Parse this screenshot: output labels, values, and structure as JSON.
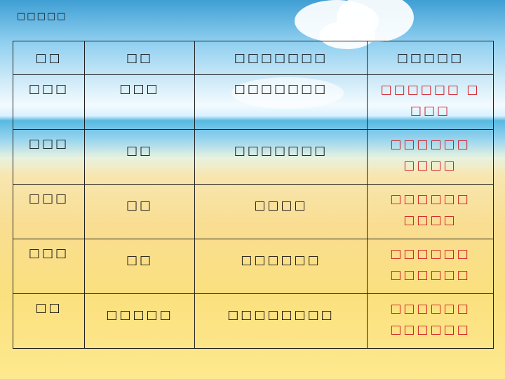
{
  "page": {
    "title": "□□□□□"
  },
  "table": {
    "headers": [
      "□□",
      "□□",
      "□□□□□□□",
      "□□□□□"
    ],
    "rows": [
      {
        "c1": "□□□",
        "c2": "□□□",
        "c3": "□□□□□□□",
        "c4a": "□□□□□□  □",
        "c4b": "□□□"
      },
      {
        "c1": "□□□",
        "c2": "□□",
        "c3": "□□□□□□□",
        "c4a": "□□□□□□",
        "c4b": "□□□□"
      },
      {
        "c1": "□□□",
        "c2": "□□",
        "c3": "□□□□",
        "c4a": "□□□□□□",
        "c4b": "□□□□"
      },
      {
        "c1": "□□□",
        "c2": "□□",
        "c3": "□□□□□□",
        "c4a": "□□□□□□",
        "c4b": "□□□□□□"
      },
      {
        "c1": "□□",
        "c2": "□□□□□",
        "c3": "□□□□□□□□",
        "c4a": "□□□□□□",
        "c4b": "□□□□□□"
      }
    ]
  }
}
